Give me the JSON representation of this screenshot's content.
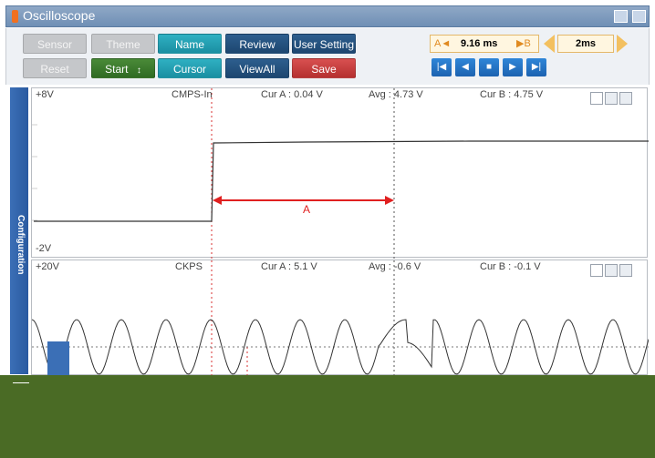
{
  "window": {
    "title": "Oscilloscope"
  },
  "toolbar": {
    "sensor": "Sensor",
    "theme": "Theme",
    "name": "Name",
    "review": "Review",
    "user_setting": "User Setting",
    "reset": "Reset",
    "start": "Start",
    "start_arrow": "↕",
    "cursor": "Cursor",
    "viewall": "ViewAll",
    "save": "Save"
  },
  "time": {
    "a_marker": "A◄",
    "delta": "9.16 ms",
    "b_marker": "▶B",
    "scale": "2ms"
  },
  "sidebar": {
    "configuration": "Configuration"
  },
  "channel1": {
    "top_range": "+8V",
    "bottom_range": "-2V",
    "name": "CMPS-In",
    "cur_a": "Cur A : 0.04 V",
    "avg": "Avg : 4.73 V",
    "cur_b": "Cur B : 4.75 V",
    "marker_label": "A"
  },
  "channel2": {
    "top_range": "+20V",
    "name": "CKPS",
    "cur_a": "Cur A : 5.1 V",
    "avg": "Avg : -0.6 V",
    "cur_b": "Cur B : -0.1 V"
  },
  "colors": {
    "accent": "#1a8fa2",
    "cursor_a": "#d02020",
    "bottom": "#4a6b25"
  }
}
